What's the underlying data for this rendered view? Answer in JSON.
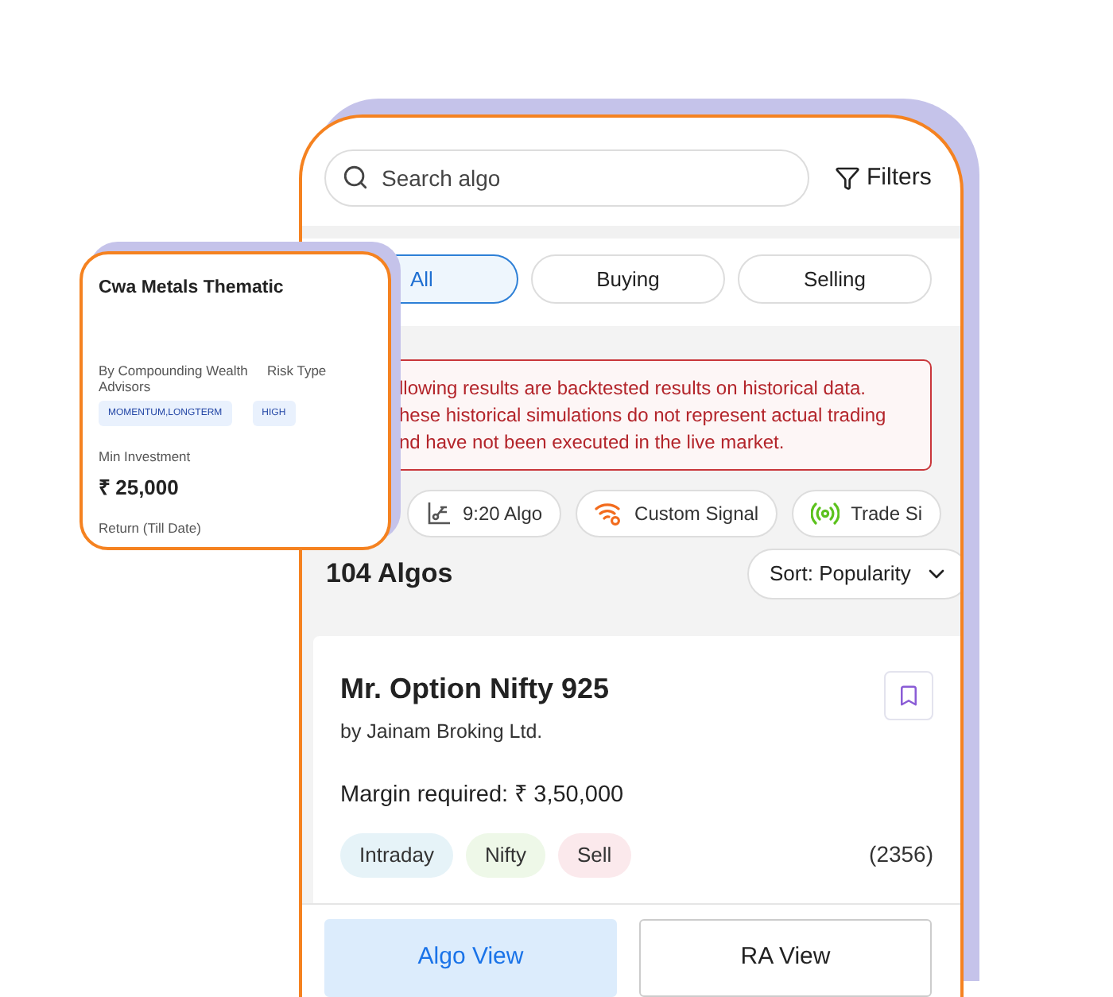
{
  "search": {
    "placeholder": "Search algo"
  },
  "filters_label": "Filters",
  "tabs": [
    {
      "label": "All",
      "selected": true
    },
    {
      "label": "Buying",
      "selected": false
    },
    {
      "label": "Selling",
      "selected": false
    }
  ],
  "disclaimer": [
    "llowing results are backtested results on historical data.",
    "hese historical simulations do not represent actual trading",
    "nd have not been executed in the live market."
  ],
  "chips": [
    {
      "label": "9:20 Algo",
      "kind": "chart"
    },
    {
      "label": "Custom Signal",
      "kind": "signal"
    },
    {
      "label": "Trade Si",
      "kind": "live"
    }
  ],
  "count": "104 Algos",
  "sort": "Sort: Popularity",
  "algo_card": {
    "title": "Mr. Option Nifty 925",
    "by": "by Jainam Broking Ltd.",
    "margin": "Margin required: ₹ 3,50,000",
    "tags": [
      {
        "label": "Intraday",
        "color": "#e6f3f8"
      },
      {
        "label": "Nifty",
        "color": "#eef8e8"
      },
      {
        "label": "Sell",
        "color": "#fbe9ec"
      }
    ],
    "reviews": "(2356)"
  },
  "bottom_tabs": [
    {
      "label": "Algo View",
      "selected": true
    },
    {
      "label": "RA View",
      "selected": false
    }
  ],
  "floating_card": {
    "title": "Cwa Metals Thematic",
    "provider": "By Compounding Wealth Advisors",
    "risk_label": "Risk Type",
    "strategy_tag": "MOMENTUM,LONGTERM",
    "risk_tag": "HIGH",
    "min_investment_label": "Min Investment",
    "min_investment": "₹ 25,000",
    "return_label": "Return (Till Date)"
  }
}
